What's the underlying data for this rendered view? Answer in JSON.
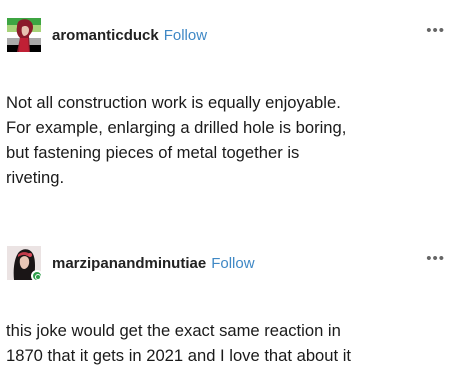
{
  "posts": [
    {
      "username": "aromanticduck",
      "follow_label": "Follow",
      "more_label": "•••",
      "body_lines": [
        "Not all construction work is equally enjoyable.",
        "For example, enlarging a drilled hole is boring,",
        "but fastening pieces of metal together is",
        "riveting."
      ]
    },
    {
      "username": "marzipanandminutiae",
      "follow_label": "Follow",
      "more_label": "•••",
      "body_lines": [
        "this joke would get the exact same reaction in",
        "1870 that it gets in 2021 and I love that about it"
      ]
    }
  ],
  "colors": {
    "follow": "#3f88c5",
    "status_badge": "#2e9e4a"
  }
}
